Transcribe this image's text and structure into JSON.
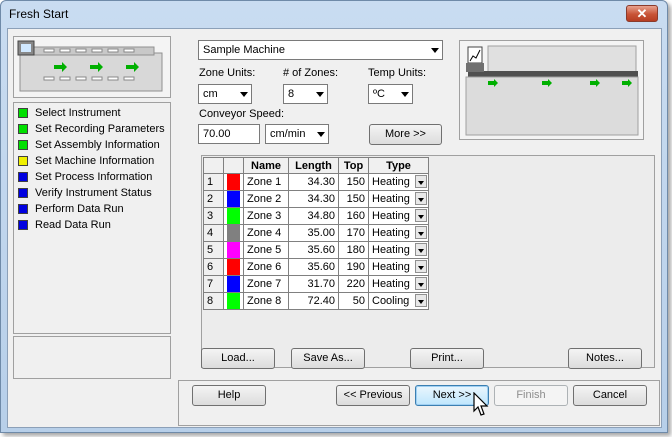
{
  "window": {
    "title": "Fresh Start",
    "close_glyph": "✕"
  },
  "steps": [
    {
      "label": "Select Instrument",
      "color": "#00e000"
    },
    {
      "label": "Set Recording Parameters",
      "color": "#00e000"
    },
    {
      "label": "Set Assembly Information",
      "color": "#00e000"
    },
    {
      "label": "Set Machine Information",
      "color": "#f0f000"
    },
    {
      "label": "Set Process Information",
      "color": "#0000e0"
    },
    {
      "label": "Verify Instrument Status",
      "color": "#0000e0"
    },
    {
      "label": "Perform Data Run",
      "color": "#0000e0"
    },
    {
      "label": "Read Data Run",
      "color": "#0000e0"
    }
  ],
  "machine": {
    "name": "Sample Machine",
    "zone_units_label": "Zone Units:",
    "zone_units_value": "cm",
    "num_zones_label": "# of Zones:",
    "num_zones_value": "8",
    "temp_units_label": "Temp Units:",
    "temp_units_value": "ºC",
    "conveyor_label": "Conveyor Speed:",
    "conveyor_value": "70.00",
    "conveyor_units": "cm/min",
    "more_label": "More >>"
  },
  "table": {
    "headers": {
      "name": "Name",
      "length": "Length",
      "top": "Top",
      "type": "Type"
    },
    "rows": [
      {
        "idx": "1",
        "color": "#ff0000",
        "name": "Zone 1",
        "length": "34.30",
        "top": "150",
        "type": "Heating"
      },
      {
        "idx": "2",
        "color": "#0000ff",
        "name": "Zone 2",
        "length": "34.30",
        "top": "150",
        "type": "Heating"
      },
      {
        "idx": "3",
        "color": "#00ff00",
        "name": "Zone 3",
        "length": "34.80",
        "top": "160",
        "type": "Heating"
      },
      {
        "idx": "4",
        "color": "#808080",
        "name": "Zone 4",
        "length": "35.00",
        "top": "170",
        "type": "Heating"
      },
      {
        "idx": "5",
        "color": "#ff00ff",
        "name": "Zone 5",
        "length": "35.60",
        "top": "180",
        "type": "Heating"
      },
      {
        "idx": "6",
        "color": "#ff0000",
        "name": "Zone 6",
        "length": "35.60",
        "top": "190",
        "type": "Heating"
      },
      {
        "idx": "7",
        "color": "#0000ff",
        "name": "Zone 7",
        "length": "31.70",
        "top": "220",
        "type": "Heating"
      },
      {
        "idx": "8",
        "color": "#00ff00",
        "name": "Zone 8",
        "length": "72.40",
        "top": "50",
        "type": "Cooling"
      }
    ]
  },
  "actions": {
    "load": "Load...",
    "save_as": "Save As...",
    "print": "Print...",
    "notes": "Notes..."
  },
  "nav": {
    "help": "Help",
    "previous": "<< Previous",
    "next": "Next >>",
    "finish": "Finish",
    "cancel": "Cancel"
  }
}
